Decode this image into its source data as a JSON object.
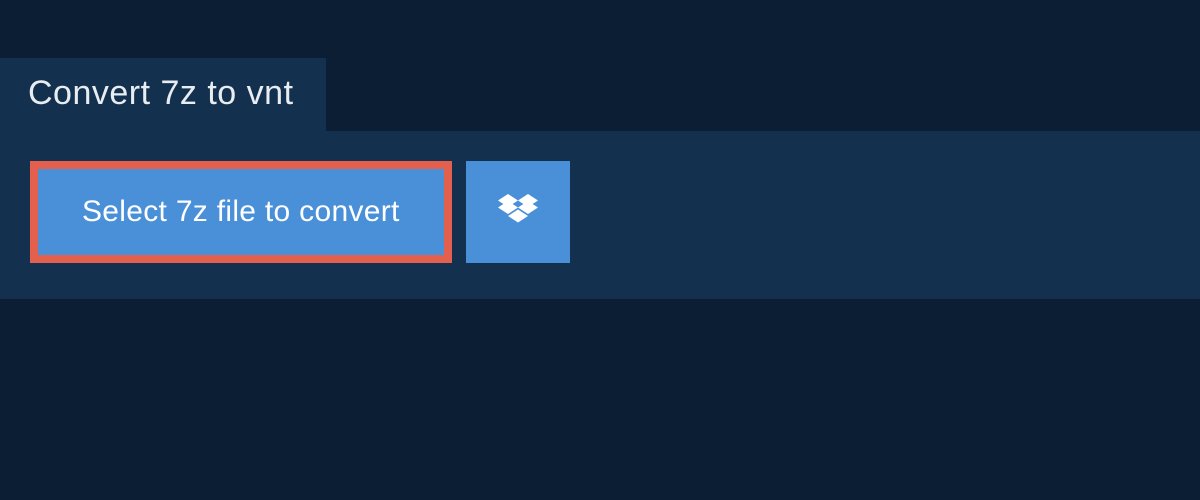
{
  "tab": {
    "title": "Convert 7z to vnt"
  },
  "buttons": {
    "select_file_label": "Select 7z file to convert",
    "dropbox_icon": "dropbox-icon"
  },
  "colors": {
    "page_bg": "#0b1e33",
    "panel_bg": "#14304f",
    "button_bg": "#4a90d9",
    "button_border": "#e4604e",
    "text_light": "#ffffff"
  }
}
